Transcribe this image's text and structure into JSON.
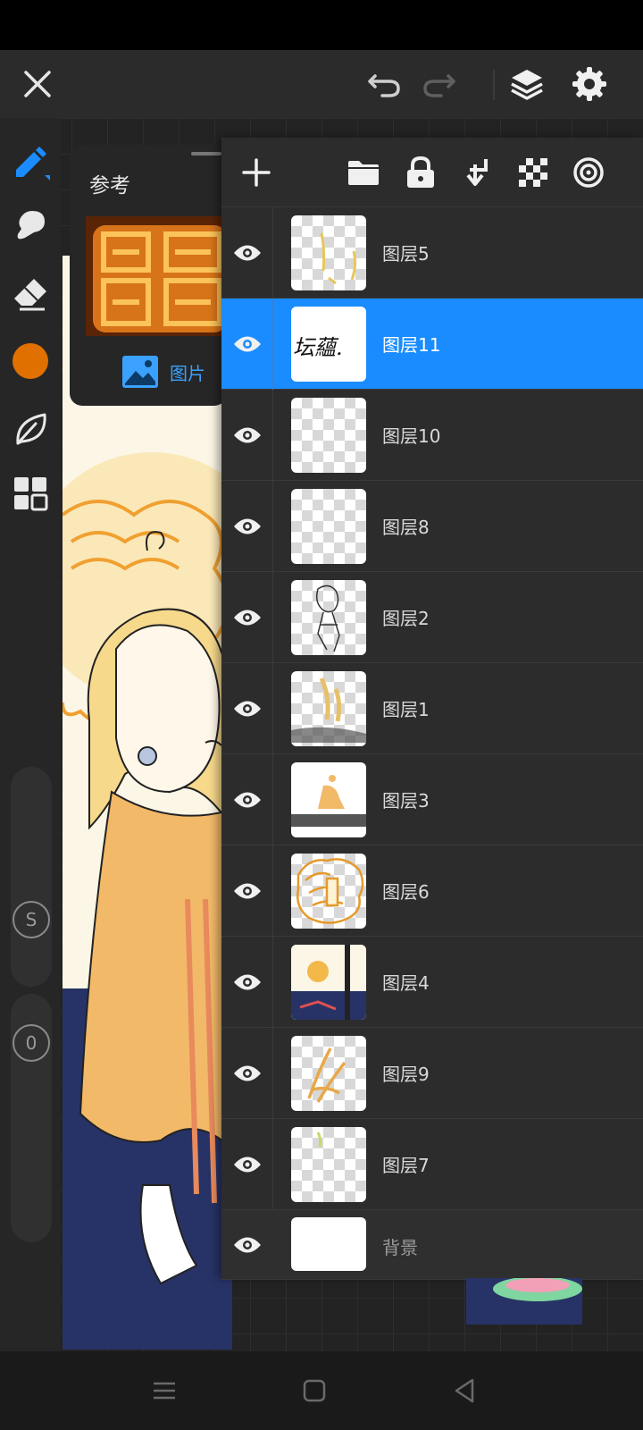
{
  "app": {
    "reference_panel": {
      "title": "参考",
      "image_button_label": "图片"
    },
    "layers": [
      {
        "name": "图层5",
        "selected": false,
        "visible": true
      },
      {
        "name": "图层11",
        "selected": true,
        "visible": true,
        "thumb_text": "坛蘊."
      },
      {
        "name": "图层10",
        "selected": false,
        "visible": true
      },
      {
        "name": "图层8",
        "selected": false,
        "visible": true
      },
      {
        "name": "图层2",
        "selected": false,
        "visible": true
      },
      {
        "name": "图层1",
        "selected": false,
        "visible": true
      },
      {
        "name": "图层3",
        "selected": false,
        "visible": true
      },
      {
        "name": "图层6",
        "selected": false,
        "visible": true
      },
      {
        "name": "图层4",
        "selected": false,
        "visible": true
      },
      {
        "name": "图层9",
        "selected": false,
        "visible": true
      },
      {
        "name": "图层7",
        "selected": false,
        "visible": true
      }
    ],
    "background_layer": {
      "name": "背景",
      "visible": true
    },
    "slider_labels": {
      "size": "S",
      "opacity": "0"
    },
    "colors": {
      "accent": "#1a8cff",
      "current_color": "#e07000"
    },
    "icons": {
      "top": [
        "close-icon",
        "undo-icon",
        "redo-icon",
        "layers-icon",
        "settings-icon"
      ],
      "layers_toolbar": [
        "add-layer-icon",
        "folder-icon",
        "lock-icon",
        "merge-down-icon",
        "transparency-icon",
        "blend-mode-icon"
      ]
    }
  }
}
